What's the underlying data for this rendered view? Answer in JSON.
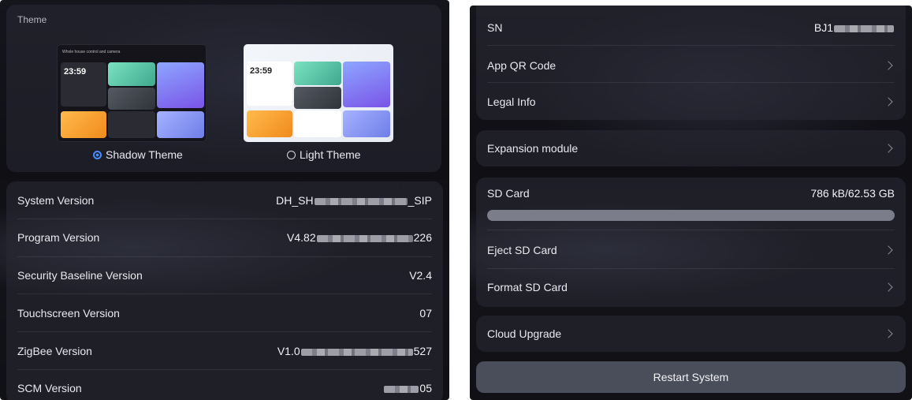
{
  "theme": {
    "title": "Theme",
    "options": [
      {
        "label": "Shadow Theme",
        "selected": true
      },
      {
        "label": "Light Theme",
        "selected": false
      }
    ],
    "preview": {
      "time": "23:59",
      "header": "Whole house control and camera"
    }
  },
  "versions": [
    {
      "label": "System Version",
      "prefix": "DH_SH",
      "suffix": "_SIP"
    },
    {
      "label": "Program Version",
      "prefix": "V4.82",
      "suffix": "226"
    },
    {
      "label": "Security Baseline Version",
      "prefix": "V2.4",
      "suffix": ""
    },
    {
      "label": "Touchscreen Version",
      "prefix": "07",
      "suffix": ""
    },
    {
      "label": "ZigBee Version",
      "prefix": "V1.0",
      "suffix": "527"
    },
    {
      "label": "SCM Version",
      "prefix": "",
      "suffix": "05"
    }
  ],
  "right": {
    "sn": {
      "label": "SN",
      "prefix": "BJ1"
    },
    "info_items": [
      {
        "label": "App QR Code"
      },
      {
        "label": "Legal Info"
      }
    ],
    "expansion": {
      "label": "Expansion module"
    },
    "sd": {
      "label": "SD Card",
      "value": "786 kB/62.53 GB",
      "usage_fraction": 0.0
    },
    "sd_items": [
      {
        "label": "Eject SD Card"
      },
      {
        "label": "Format SD Card"
      }
    ],
    "cloud": {
      "label": "Cloud Upgrade"
    },
    "restart": {
      "label": "Restart System"
    }
  },
  "colors": {
    "accent": "#4a8cff",
    "panel_bg": "#121218",
    "card_bg": "#2a2a37"
  }
}
